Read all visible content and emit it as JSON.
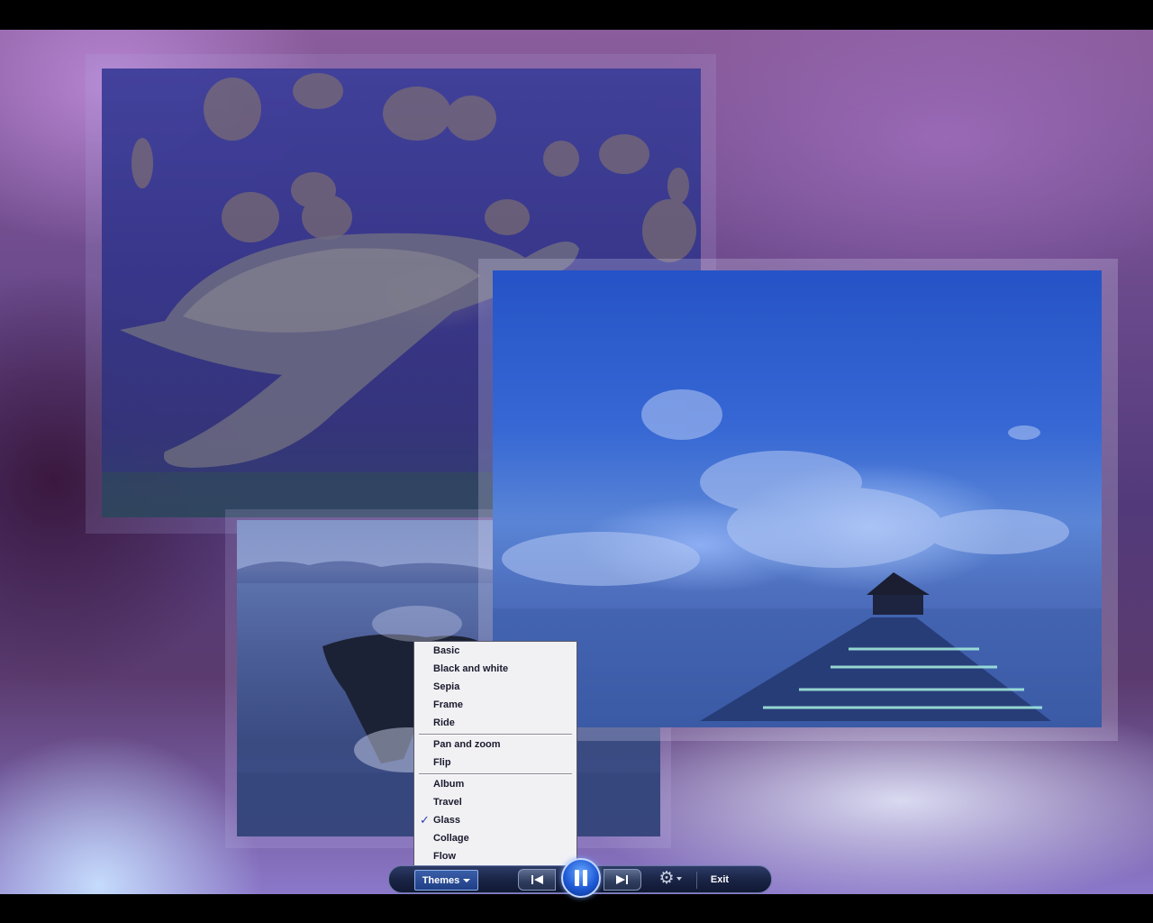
{
  "themes_menu": {
    "items": [
      {
        "label": "Basic"
      },
      {
        "label": "Black and white"
      },
      {
        "label": "Sepia"
      },
      {
        "label": "Frame"
      },
      {
        "label": "Ride"
      },
      {
        "label": "Pan and zoom"
      },
      {
        "label": "Flip"
      },
      {
        "label": "Album"
      },
      {
        "label": "Travel"
      },
      {
        "label": "Glass",
        "checked": true
      },
      {
        "label": "Collage"
      },
      {
        "label": "Flow"
      }
    ],
    "check_glyph": "✓"
  },
  "control_bar": {
    "themes_label": "Themes",
    "exit_label": "Exit",
    "icons": {
      "themes": "caret-down-icon",
      "previous": "skip-previous-icon",
      "play_pause": "pause-icon",
      "next": "skip-next-icon",
      "settings": "gear-icon"
    },
    "gear_glyph": "⚙"
  },
  "photos": [
    {
      "subject": "sea-turtle-with-fish"
    },
    {
      "subject": "whale-breaching"
    },
    {
      "subject": "pier-at-dusk"
    }
  ],
  "colors": {
    "accent": "#2c3fb3",
    "bar_background": "#1a2446",
    "menu_background": "#f1f1f4"
  }
}
